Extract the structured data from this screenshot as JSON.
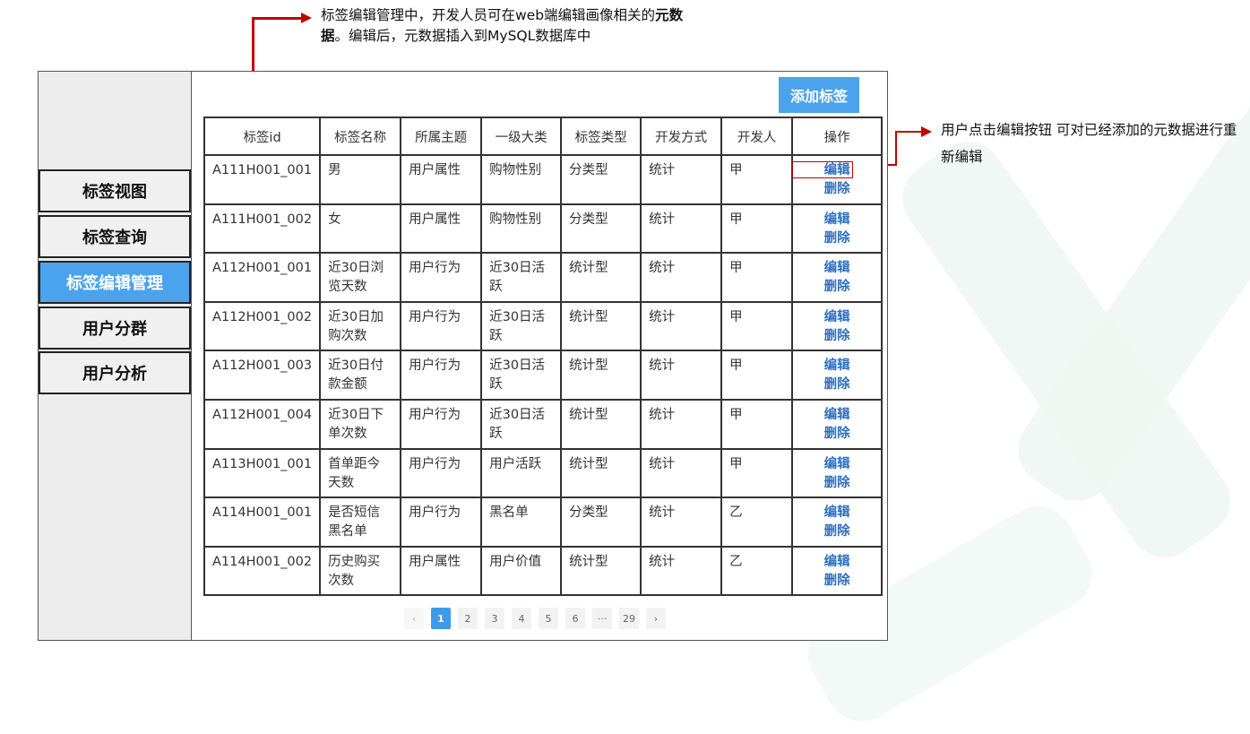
{
  "annotations": {
    "top_text": "标签编辑管理中，开发人员可在web端编辑画像相关的",
    "top_bold1": "元数",
    "top_bold2": "据",
    "top_rest": "。编辑后，元数据插入到MySQL数据库中",
    "right_text": "用户点击编辑按钮 可对已经添加的元数据进行重新编辑"
  },
  "sidebar": {
    "items": [
      {
        "label": "标签视图"
      },
      {
        "label": "标签查询"
      },
      {
        "label": "标签编辑管理"
      },
      {
        "label": "用户分群"
      },
      {
        "label": "用户分析"
      }
    ],
    "active_index": 2
  },
  "toolbar": {
    "add_label": "添加标签"
  },
  "table": {
    "headers": [
      "标签id",
      "标签名称",
      "所属主题",
      "一级大类",
      "标签类型",
      "开发方式",
      "开发人",
      "操作"
    ],
    "edit_label": "编辑",
    "delete_label": "删除",
    "rows": [
      [
        "A111H001_001",
        "男",
        "用户属性",
        "购物性别",
        "分类型",
        "统计",
        "甲"
      ],
      [
        "A111H001_002",
        "女",
        "用户属性",
        "购物性别",
        "分类型",
        "统计",
        "甲"
      ],
      [
        "A112H001_001",
        "近30日浏览天数",
        "用户行为",
        "近30日活跃",
        "统计型",
        "统计",
        "甲"
      ],
      [
        "A112H001_002",
        "近30日加购次数",
        "用户行为",
        "近30日活跃",
        "统计型",
        "统计",
        "甲"
      ],
      [
        "A112H001_003",
        "近30日付款金额",
        "用户行为",
        "近30日活跃",
        "统计型",
        "统计",
        "甲"
      ],
      [
        "A112H001_004",
        "近30日下单次数",
        "用户行为",
        "近30日活跃",
        "统计型",
        "统计",
        "甲"
      ],
      [
        "A113H001_001",
        "首单距今天数",
        "用户行为",
        "用户活跃",
        "统计型",
        "统计",
        "甲"
      ],
      [
        "A114H001_001",
        "是否短信黑名单",
        "用户行为",
        "黑名单",
        "分类型",
        "统计",
        "乙"
      ],
      [
        "A114H001_002",
        "历史购买次数",
        "用户属性",
        "用户价值",
        "统计型",
        "统计",
        "乙"
      ]
    ]
  },
  "pagination": {
    "prev": "‹",
    "pages": [
      "1",
      "2",
      "3",
      "4",
      "5",
      "6",
      "···",
      "29"
    ],
    "active_page": "1",
    "next": "›"
  },
  "colors": {
    "accent": "#4aa3ec",
    "annotation": "#c00000",
    "link": "#2e6fc0"
  }
}
